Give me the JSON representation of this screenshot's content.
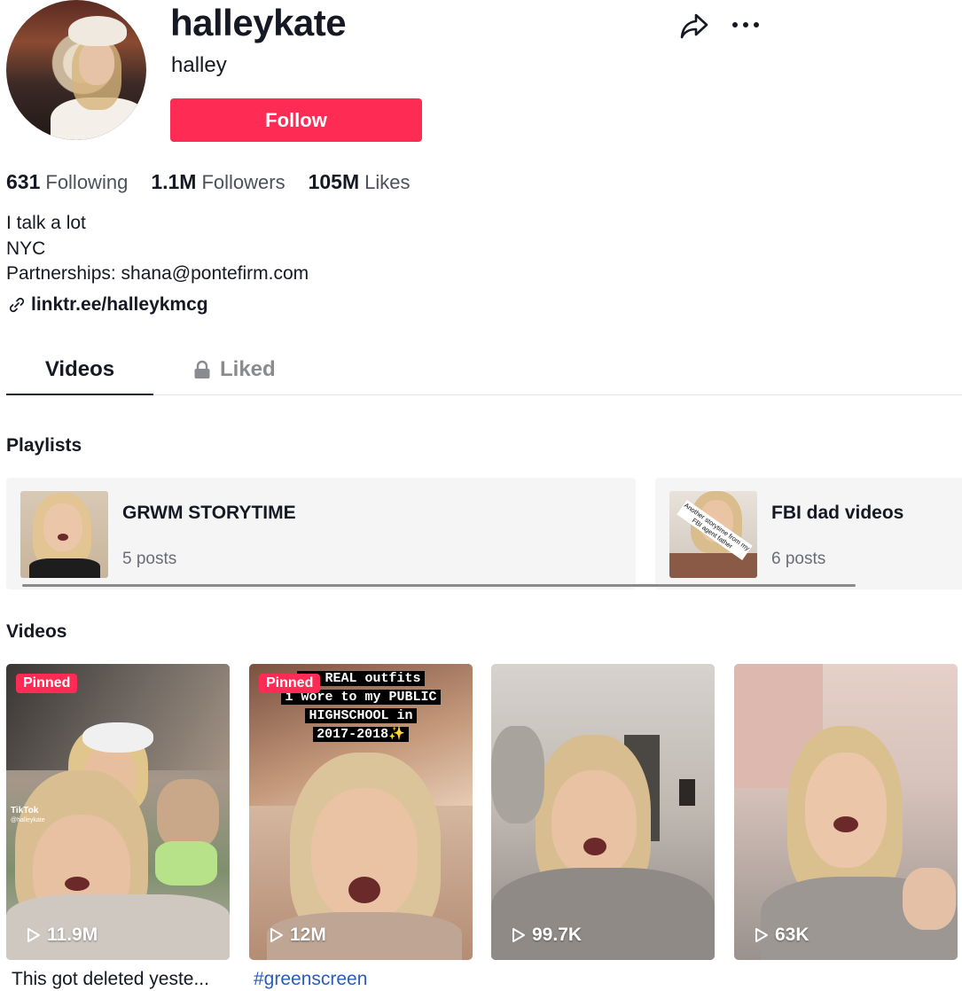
{
  "profile": {
    "username": "halleykate",
    "nickname": "halley",
    "follow_label": "Follow",
    "stats": {
      "following_count": "631",
      "following_label": "Following",
      "followers_count": "1.1M",
      "followers_label": "Followers",
      "likes_count": "105M",
      "likes_label": "Likes"
    },
    "bio": [
      "I talk a lot",
      "NYC",
      "Partnerships: shana@pontefirm.com"
    ],
    "link": "linktr.ee/halleykmcg"
  },
  "header_icons": {
    "share": "share-icon",
    "more": "more-icon"
  },
  "tabs": {
    "videos": "Videos",
    "liked": "Liked"
  },
  "playlists": {
    "title": "Playlists",
    "items": [
      {
        "title": "GRWM STORYTIME",
        "count": "5 posts"
      },
      {
        "title": "FBI dad videos",
        "count": "6 posts",
        "thumb_overlay": "Another storytime from my FBI agent father"
      }
    ]
  },
  "videos": {
    "title": "Videos",
    "items": [
      {
        "pinned": "Pinned",
        "views": "11.9M",
        "caption": "This got deleted yeste...",
        "watermark": "TikTok",
        "watermark_handle": "@halleykate"
      },
      {
        "pinned": "Pinned",
        "views": "12M",
        "caption": "#greenscreen",
        "overlay": [
          "ng REAL outfits",
          "i wore to my PUBLIC",
          "HIGHSCHOOL in",
          "2017-2018✨"
        ]
      },
      {
        "views": "99.7K"
      },
      {
        "views": "63K"
      }
    ]
  },
  "colors": {
    "accent": "#fe2c55",
    "text": "#161823",
    "muted": "#8a8b91",
    "link": "#2b5db8"
  }
}
